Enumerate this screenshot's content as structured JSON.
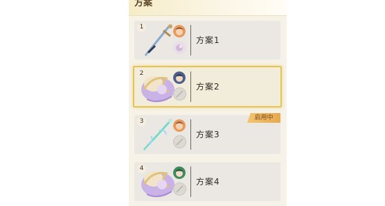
{
  "panel": {
    "title": "方案",
    "active_tag": "启用中",
    "schemes": [
      {
        "index": "1",
        "name": "方案1",
        "art_icon": "sword-icon",
        "avatar_icon": "character-avatar-icon",
        "sub_icon": "pet-icon"
      },
      {
        "index": "2",
        "name": "方案2",
        "art_icon": "mount-icon",
        "avatar_icon": "character-avatar-icon",
        "sub_icon": "empty-slot-icon",
        "selected": true
      },
      {
        "index": "3",
        "name": "方案3",
        "art_icon": "sword-icon",
        "avatar_icon": "character-avatar-icon",
        "sub_icon": "empty-slot-icon",
        "in_use": true
      },
      {
        "index": "4",
        "name": "方案4",
        "art_icon": "mount-icon",
        "avatar_icon": "character-avatar-icon",
        "sub_icon": "empty-slot-icon"
      }
    ]
  },
  "colors": {
    "selected_border": "#e6c54f",
    "tag_background": "#e8a84f"
  }
}
